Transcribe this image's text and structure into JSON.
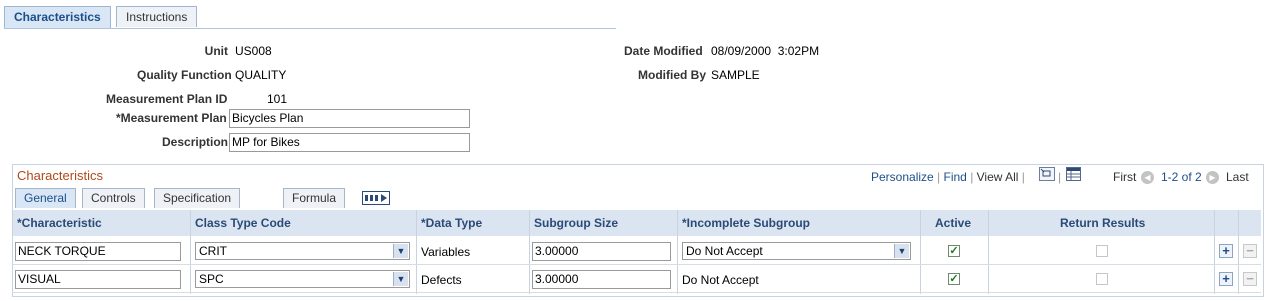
{
  "tabs": {
    "characteristics": "Characteristics",
    "instructions": "Instructions"
  },
  "header": {
    "unit_label": "Unit",
    "unit_value": "US008",
    "qf_label": "Quality Function",
    "qf_value": "QUALITY",
    "mpid_label": "Measurement Plan ID",
    "mpid_value": "101",
    "mp_label": "*Measurement Plan",
    "mp_value": "Bicycles Plan",
    "desc_label": "Description",
    "desc_value": "MP for Bikes",
    "date_label": "Date Modified",
    "date_value": "08/09/2000  3:02PM",
    "modby_label": "Modified By",
    "modby_value": "SAMPLE"
  },
  "grid": {
    "title": "Characteristics",
    "personalize": "Personalize",
    "find": "Find",
    "view_all": "View All",
    "first": "First",
    "range": "1-2 of 2",
    "last": "Last",
    "subtabs": [
      "General",
      "Controls",
      "Specification Limits",
      "Formula"
    ],
    "columns": {
      "characteristic": "*Characteristic",
      "class_type": "Class Type Code",
      "data_type": "*Data Type",
      "subgroup": "Subgroup Size",
      "incomplete": "*Incomplete Subgroup",
      "active": "Active",
      "return": "Return Results"
    },
    "rows": [
      {
        "characteristic": "NECK TORQUE",
        "class_type": "CRIT",
        "data_type": "Variables",
        "subgroup": "3.00000",
        "incomplete": "Do Not Accept",
        "active": true,
        "return": false
      },
      {
        "characteristic": "VISUAL",
        "class_type": "SPC",
        "data_type": "Defects",
        "subgroup": "3.00000",
        "incomplete": "Do Not Accept",
        "active": true,
        "return": false
      }
    ]
  },
  "icons": {
    "add": "add-row-icon",
    "delete": "delete-row-icon",
    "zoom": "zoom-icon",
    "spreadsheet": "spreadsheet-icon",
    "prev": "prev-arrow-icon",
    "next": "next-arrow-icon",
    "showall": "show-all-columns-icon"
  }
}
